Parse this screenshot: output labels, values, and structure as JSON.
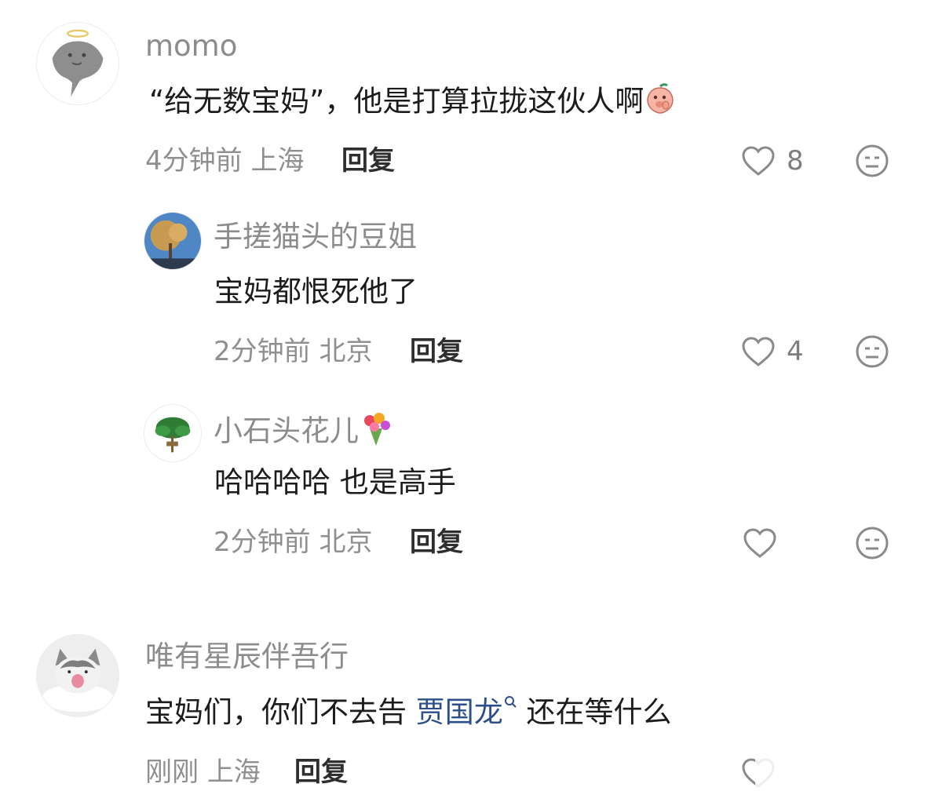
{
  "comments": [
    {
      "username": "momo",
      "text": "“给无数宝妈”，他是打算拉拢这伙人啊",
      "time": "4分钟前",
      "location": "上海",
      "reply_label": "回复",
      "likes": "8",
      "replies": [
        {
          "username": "手搓猫头的豆姐",
          "text": "宝妈都恨死他了",
          "time": "2分钟前",
          "location": "北京",
          "reply_label": "回复",
          "likes": "4"
        },
        {
          "username": "小石头花儿",
          "text": "哈哈哈哈 也是高手",
          "time": "2分钟前",
          "location": "北京",
          "reply_label": "回复",
          "likes": ""
        }
      ]
    },
    {
      "username": "唯有星辰伴吾行",
      "text_before": "宝妈们，你们不去告 ",
      "mention": "贾国龙",
      "text_after": " 还在等什么",
      "time": "刚刚",
      "location": "上海",
      "reply_label": "回复"
    }
  ],
  "colors": {
    "username": "#8c8c8c",
    "body": "#1c1c1c",
    "meta": "#8f8f8f",
    "mention": "#2c4f8a"
  },
  "icons": [
    "like-heart-icon",
    "dislike-face-icon",
    "search-icon",
    "peach-emoji",
    "bouquet-emoji"
  ]
}
